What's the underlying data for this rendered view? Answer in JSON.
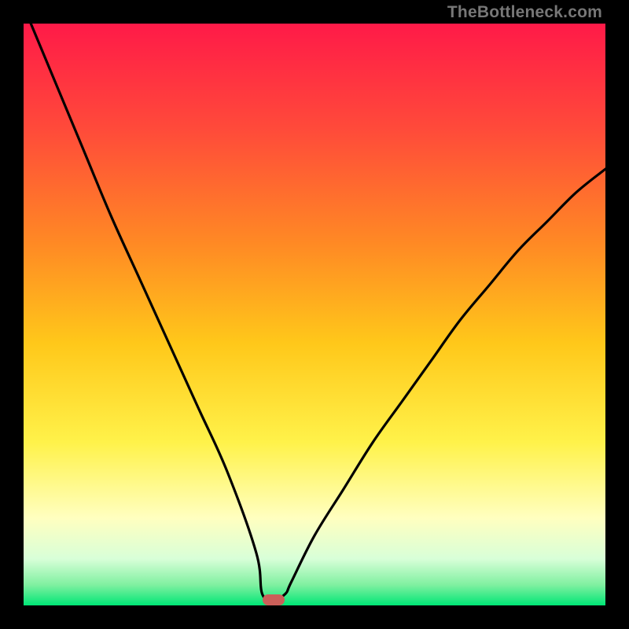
{
  "watermark": "TheBottleneck.com",
  "colors": {
    "frame_bg": "#000000",
    "curve": "#000000",
    "marker": "#cb5f59",
    "grad_top": "#ff1a48",
    "grad_upper": "#ff5a33",
    "grad_mid_high": "#ff9a1e",
    "grad_mid": "#ffd11a",
    "grad_mid_low": "#fff24a",
    "grad_pale": "#ffffcf",
    "grad_green_soft": "#9df2b3",
    "grad_green": "#00e676"
  },
  "chart_data": {
    "type": "line",
    "title": "",
    "xlabel": "",
    "ylabel": "",
    "xlim": [
      0,
      100
    ],
    "ylim": [
      0,
      100
    ],
    "grid": false,
    "legend": false,
    "marker": {
      "x": 43,
      "y": 1
    },
    "series": [
      {
        "name": "curve",
        "x": [
          0,
          5,
          10,
          15,
          20,
          25,
          30,
          35,
          40,
          41,
          43,
          45,
          46,
          50,
          55,
          60,
          65,
          70,
          75,
          80,
          85,
          90,
          95,
          100
        ],
        "y": [
          103,
          91,
          79,
          67,
          56,
          45,
          34,
          23,
          9,
          2,
          1,
          2,
          4,
          12,
          20,
          28,
          35,
          42,
          49,
          55,
          61,
          66,
          71,
          75
        ]
      }
    ],
    "background_gradient_stops": [
      {
        "pos": 0.0,
        "color": "#ff1a48"
      },
      {
        "pos": 0.18,
        "color": "#ff4a3a"
      },
      {
        "pos": 0.38,
        "color": "#ff8a24"
      },
      {
        "pos": 0.55,
        "color": "#ffc81a"
      },
      {
        "pos": 0.72,
        "color": "#fff24a"
      },
      {
        "pos": 0.85,
        "color": "#ffffc0"
      },
      {
        "pos": 0.92,
        "color": "#d8ffd8"
      },
      {
        "pos": 0.965,
        "color": "#7ff0a0"
      },
      {
        "pos": 1.0,
        "color": "#00e676"
      }
    ]
  }
}
